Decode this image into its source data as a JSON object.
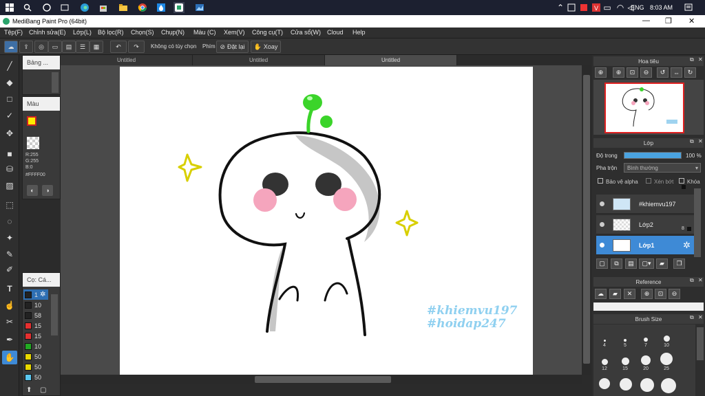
{
  "taskbar": {
    "tray_lang": "ENG",
    "time": "8:03 AM"
  },
  "window": {
    "title": "MediBang Paint Pro (64bit)"
  },
  "menu": [
    "Tệp(F)",
    "Chỉnh sửa(E)",
    "Lớp(L)",
    "Bộ lọc(R)",
    "Chọn(S)",
    "Chụp(N)",
    "Màu (C)",
    "Xem(V)",
    "Công cụ(T)",
    "Cửa sổ(W)",
    "Cloud",
    "Help"
  ],
  "toolbar": {
    "snap_label": "Không có tùy chọn",
    "key_label": "Phím",
    "reset_label": "Đặt lại",
    "rotate_label": "Xoay"
  },
  "left_panels": {
    "brush_panel_title": "Bảng ...",
    "color_panel_title": "Màu",
    "rgb_r": "R:255",
    "rgb_g": "G:255",
    "rgb_b": "B:0",
    "hex": "#FFFF00",
    "brush_list_title": "Cọ: Cá..."
  },
  "brush_sizes_list": [
    "1",
    "10",
    "58",
    "15",
    "15",
    "10",
    "50",
    "50",
    "50"
  ],
  "brush_sizes_colors": [
    "#222",
    "#222",
    "#222",
    "#e53030",
    "#e53030",
    "#22aa22",
    "#e8d800",
    "#e8d800",
    "#5bc8f0"
  ],
  "tabs": [
    "Untitled",
    "Untitled",
    "Untitled"
  ],
  "navigator": {
    "title": "Hoa tiêu"
  },
  "layers_panel": {
    "title": "Lớp",
    "opacity_label": "Độ trong",
    "opacity_value": "100 %",
    "opacity_fraction": 1.0,
    "blend_label": "Pha trộn",
    "blend_value": "Bình thường",
    "protect_alpha": "Bảo vệ alpha",
    "clip": "Xén bớt",
    "lock": "Khóa",
    "layers": [
      {
        "name": "#khiemvu197",
        "badge": ""
      },
      {
        "name": "Lớp2",
        "badge": "8"
      },
      {
        "name": "Lớp1",
        "badge": "8"
      }
    ]
  },
  "reference": {
    "title": "Reference"
  },
  "brush_size_panel": {
    "title": "Brush Size",
    "sizes": [
      "4",
      "5",
      "7",
      "10",
      "12",
      "15",
      "20",
      "25"
    ]
  },
  "artwork": {
    "text_line1": "#khiemvu197",
    "text_line2": "#hoidap247",
    "text_color": "#8fd0f0"
  }
}
